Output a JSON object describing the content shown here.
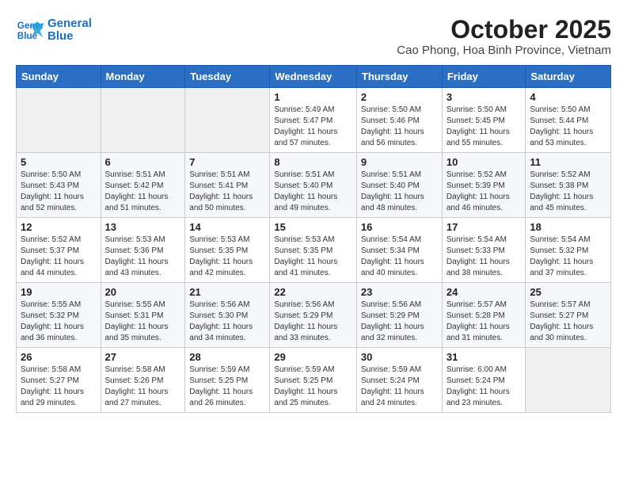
{
  "logo": {
    "line1": "General",
    "line2": "Blue"
  },
  "title": "October 2025",
  "subtitle": "Cao Phong, Hoa Binh Province, Vietnam",
  "headers": [
    "Sunday",
    "Monday",
    "Tuesday",
    "Wednesday",
    "Thursday",
    "Friday",
    "Saturday"
  ],
  "weeks": [
    [
      {
        "day": "",
        "info": ""
      },
      {
        "day": "",
        "info": ""
      },
      {
        "day": "",
        "info": ""
      },
      {
        "day": "1",
        "info": "Sunrise: 5:49 AM\nSunset: 5:47 PM\nDaylight: 11 hours and 57 minutes."
      },
      {
        "day": "2",
        "info": "Sunrise: 5:50 AM\nSunset: 5:46 PM\nDaylight: 11 hours and 56 minutes."
      },
      {
        "day": "3",
        "info": "Sunrise: 5:50 AM\nSunset: 5:45 PM\nDaylight: 11 hours and 55 minutes."
      },
      {
        "day": "4",
        "info": "Sunrise: 5:50 AM\nSunset: 5:44 PM\nDaylight: 11 hours and 53 minutes."
      }
    ],
    [
      {
        "day": "5",
        "info": "Sunrise: 5:50 AM\nSunset: 5:43 PM\nDaylight: 11 hours and 52 minutes."
      },
      {
        "day": "6",
        "info": "Sunrise: 5:51 AM\nSunset: 5:42 PM\nDaylight: 11 hours and 51 minutes."
      },
      {
        "day": "7",
        "info": "Sunrise: 5:51 AM\nSunset: 5:41 PM\nDaylight: 11 hours and 50 minutes."
      },
      {
        "day": "8",
        "info": "Sunrise: 5:51 AM\nSunset: 5:40 PM\nDaylight: 11 hours and 49 minutes."
      },
      {
        "day": "9",
        "info": "Sunrise: 5:51 AM\nSunset: 5:40 PM\nDaylight: 11 hours and 48 minutes."
      },
      {
        "day": "10",
        "info": "Sunrise: 5:52 AM\nSunset: 5:39 PM\nDaylight: 11 hours and 46 minutes."
      },
      {
        "day": "11",
        "info": "Sunrise: 5:52 AM\nSunset: 5:38 PM\nDaylight: 11 hours and 45 minutes."
      }
    ],
    [
      {
        "day": "12",
        "info": "Sunrise: 5:52 AM\nSunset: 5:37 PM\nDaylight: 11 hours and 44 minutes."
      },
      {
        "day": "13",
        "info": "Sunrise: 5:53 AM\nSunset: 5:36 PM\nDaylight: 11 hours and 43 minutes."
      },
      {
        "day": "14",
        "info": "Sunrise: 5:53 AM\nSunset: 5:35 PM\nDaylight: 11 hours and 42 minutes."
      },
      {
        "day": "15",
        "info": "Sunrise: 5:53 AM\nSunset: 5:35 PM\nDaylight: 11 hours and 41 minutes."
      },
      {
        "day": "16",
        "info": "Sunrise: 5:54 AM\nSunset: 5:34 PM\nDaylight: 11 hours and 40 minutes."
      },
      {
        "day": "17",
        "info": "Sunrise: 5:54 AM\nSunset: 5:33 PM\nDaylight: 11 hours and 38 minutes."
      },
      {
        "day": "18",
        "info": "Sunrise: 5:54 AM\nSunset: 5:32 PM\nDaylight: 11 hours and 37 minutes."
      }
    ],
    [
      {
        "day": "19",
        "info": "Sunrise: 5:55 AM\nSunset: 5:32 PM\nDaylight: 11 hours and 36 minutes."
      },
      {
        "day": "20",
        "info": "Sunrise: 5:55 AM\nSunset: 5:31 PM\nDaylight: 11 hours and 35 minutes."
      },
      {
        "day": "21",
        "info": "Sunrise: 5:56 AM\nSunset: 5:30 PM\nDaylight: 11 hours and 34 minutes."
      },
      {
        "day": "22",
        "info": "Sunrise: 5:56 AM\nSunset: 5:29 PM\nDaylight: 11 hours and 33 minutes."
      },
      {
        "day": "23",
        "info": "Sunrise: 5:56 AM\nSunset: 5:29 PM\nDaylight: 11 hours and 32 minutes."
      },
      {
        "day": "24",
        "info": "Sunrise: 5:57 AM\nSunset: 5:28 PM\nDaylight: 11 hours and 31 minutes."
      },
      {
        "day": "25",
        "info": "Sunrise: 5:57 AM\nSunset: 5:27 PM\nDaylight: 11 hours and 30 minutes."
      }
    ],
    [
      {
        "day": "26",
        "info": "Sunrise: 5:58 AM\nSunset: 5:27 PM\nDaylight: 11 hours and 29 minutes."
      },
      {
        "day": "27",
        "info": "Sunrise: 5:58 AM\nSunset: 5:26 PM\nDaylight: 11 hours and 27 minutes."
      },
      {
        "day": "28",
        "info": "Sunrise: 5:59 AM\nSunset: 5:25 PM\nDaylight: 11 hours and 26 minutes."
      },
      {
        "day": "29",
        "info": "Sunrise: 5:59 AM\nSunset: 5:25 PM\nDaylight: 11 hours and 25 minutes."
      },
      {
        "day": "30",
        "info": "Sunrise: 5:59 AM\nSunset: 5:24 PM\nDaylight: 11 hours and 24 minutes."
      },
      {
        "day": "31",
        "info": "Sunrise: 6:00 AM\nSunset: 5:24 PM\nDaylight: 11 hours and 23 minutes."
      },
      {
        "day": "",
        "info": ""
      }
    ]
  ]
}
